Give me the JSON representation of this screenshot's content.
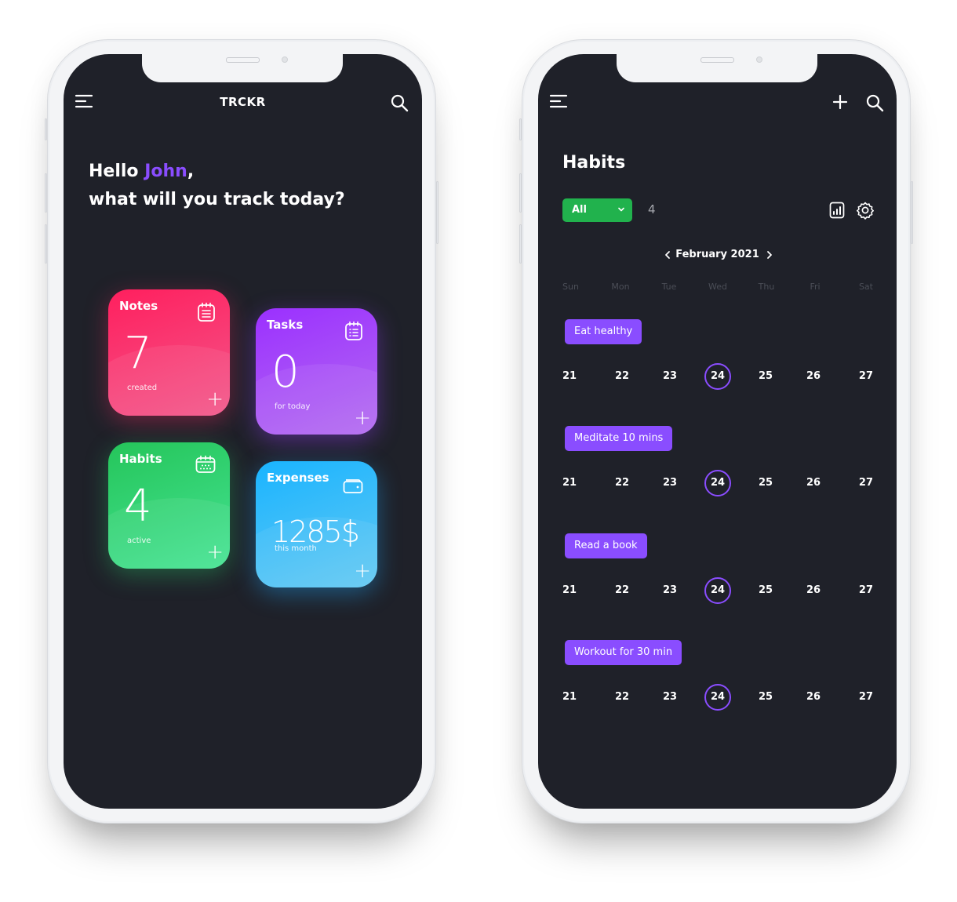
{
  "left_phone": {
    "header": {
      "app_title": "TRCKR",
      "menu_icon": "menu-icon",
      "search_icon": "search-icon"
    },
    "greeting": {
      "hello": "Hello ",
      "name": "John",
      "comma": ",",
      "question": "what will you track today?"
    },
    "cards": [
      {
        "title": "Notes",
        "value": "7",
        "subtitle": "created",
        "icon": "notepad-icon",
        "color": "#ff2a66"
      },
      {
        "title": "Tasks",
        "value": "0",
        "subtitle": "for today",
        "icon": "checklist-icon",
        "color": "#a043ff"
      },
      {
        "title": "Habits",
        "value": "4",
        "subtitle": "active",
        "icon": "calendar-icon",
        "color": "#2fd06f"
      },
      {
        "title": "Expenses",
        "value": "1285$",
        "subtitle": "this month",
        "icon": "wallet-icon",
        "color": "#2bb8ff"
      }
    ],
    "add_label": "+"
  },
  "right_phone": {
    "header": {
      "menu_icon": "menu-icon",
      "add_icon": "plus-icon",
      "search_icon": "search-icon"
    },
    "title": "Habits",
    "filter": {
      "selected": "All",
      "color": "#21b24d"
    },
    "count": "4",
    "month": "February 2021",
    "weekdays": [
      "Sun",
      "Mon",
      "Tue",
      "Wed",
      "Thu",
      "Fri",
      "Sat"
    ],
    "week_days": [
      "21",
      "22",
      "23",
      "24",
      "25",
      "26",
      "27"
    ],
    "today": "24",
    "accent": "#8a4dff",
    "habits": [
      {
        "name": "Eat healthy"
      },
      {
        "name": "Meditate 10 mins"
      },
      {
        "name": "Read a book"
      },
      {
        "name": "Workout for 30 min"
      }
    ]
  }
}
